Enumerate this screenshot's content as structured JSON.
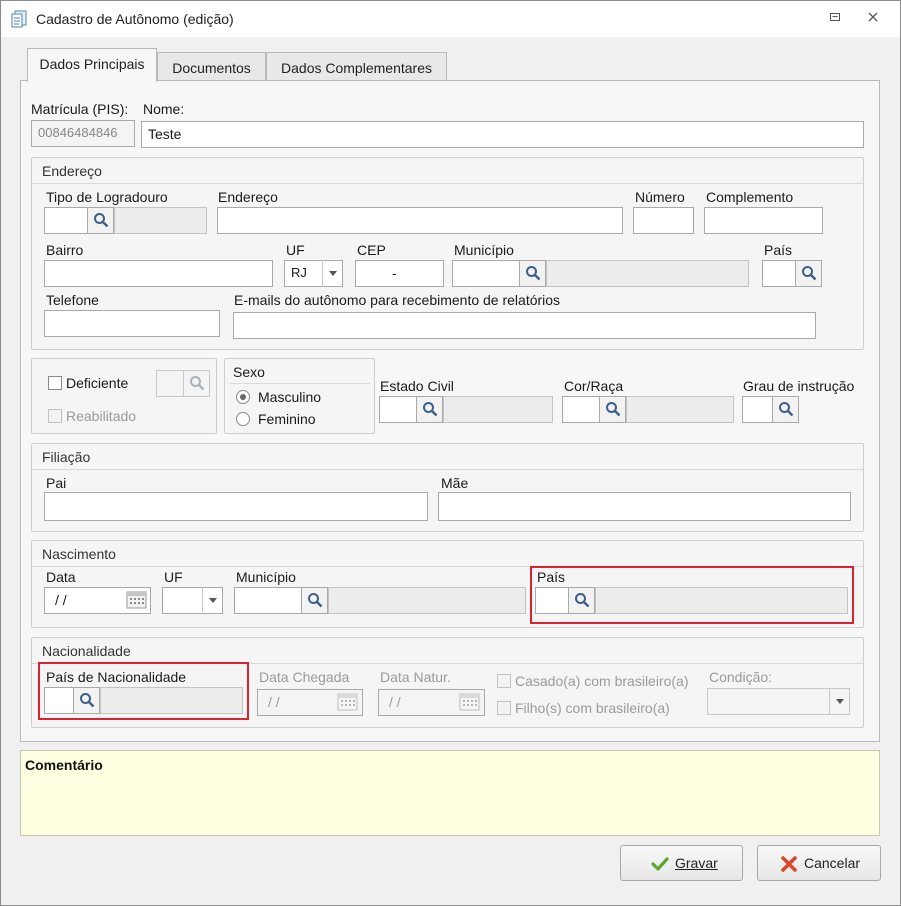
{
  "window": {
    "title": "Cadastro de Autônomo (edição)"
  },
  "tabs": [
    {
      "label": "Dados Principais"
    },
    {
      "label": "Documentos"
    },
    {
      "label": "Dados Complementares"
    }
  ],
  "main": {
    "matricula_label": "Matrícula (PIS):",
    "matricula_value": "00846484846",
    "nome_label": "Nome:",
    "nome_value": "Teste"
  },
  "endereco": {
    "title": "Endereço",
    "tipo_logradouro_label": "Tipo de Logradouro",
    "endereco_label": "Endereço",
    "numero_label": "Número",
    "complemento_label": "Complemento",
    "bairro_label": "Bairro",
    "uf_label": "UF",
    "uf_value": "RJ",
    "cep_label": "CEP",
    "cep_value": "-",
    "municipio_label": "Município",
    "pais_label": "País",
    "telefone_label": "Telefone",
    "emails_label": "E-mails do autônomo para recebimento de relatórios"
  },
  "pessoal": {
    "deficiente_label": "Deficiente",
    "reabilitado_label": "Reabilitado",
    "sexo_title": "Sexo",
    "masculino_label": "Masculino",
    "feminino_label": "Feminino",
    "selected_sexo": "Masculino",
    "estado_civil_label": "Estado Civil",
    "cor_raca_label": "Cor/Raça",
    "grau_instrucao_label": "Grau de instrução"
  },
  "filiacao": {
    "title": "Filiação",
    "pai_label": "Pai",
    "mae_label": "Mãe"
  },
  "nascimento": {
    "title": "Nascimento",
    "data_label": "Data",
    "data_value": "/ /",
    "uf_label": "UF",
    "municipio_label": "Município",
    "pais_label": "País"
  },
  "nacionalidade": {
    "title": "Nacionalidade",
    "pais_label": "País de Nacionalidade",
    "data_chegada_label": "Data Chegada",
    "data_chegada_value": "/ /",
    "data_natur_label": "Data Natur.",
    "data_natur_value": "/ /",
    "casado_label": "Casado(a) com brasileiro(a)",
    "filhos_label": "Filho(s) com brasileiro(a)",
    "condicao_label": "Condição:"
  },
  "comment": {
    "label": "Comentário"
  },
  "buttons": {
    "gravar": "Gravar",
    "cancelar": "Cancelar"
  },
  "colors": {
    "highlight": "#d9232e",
    "comment_bg": "#ffffe1",
    "ok_green": "#5aa832",
    "cancel_red": "#d9482b"
  }
}
